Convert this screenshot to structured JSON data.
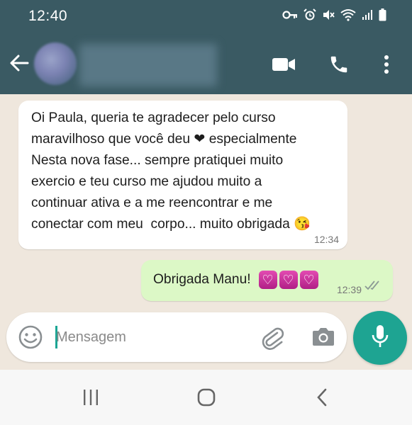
{
  "status_bar": {
    "time": "12:40",
    "icons": [
      "key-icon",
      "alarm-icon",
      "mute-icon",
      "wifi-icon",
      "signal-icon",
      "battery-icon"
    ]
  },
  "header": {
    "contact_name": "",
    "icons": [
      "back-arrow-icon",
      "video-call-icon",
      "voice-call-icon",
      "more-options-icon"
    ],
    "colors": {
      "bar": "#3a5a63"
    }
  },
  "messages": [
    {
      "direction": "incoming",
      "lines": [
        "Oi Paula, queria te agradecer pelo curso",
        "maravilhoso que você deu ❤ especialmente",
        "Nesta nova fase... sempre pratiquei muito",
        "exercio e teu curso me ajudou muito a",
        "continuar ativa e a me reencontrar e me",
        "conectar com meu  corpo... muito obrigada 😘"
      ],
      "time": "12:34"
    },
    {
      "direction": "outgoing",
      "text": "Obrigada Manu!",
      "emoji": [
        "💟",
        "💟",
        "💟"
      ],
      "time": "12:39",
      "status": "read-ticks-icon"
    }
  ],
  "composer": {
    "placeholder": "Mensagem",
    "value": "",
    "icons": [
      "emoji-icon",
      "attach-icon",
      "camera-icon",
      "mic-icon"
    ],
    "accent": "#1ea492"
  },
  "nav": {
    "icons": [
      "recent-apps-icon",
      "home-icon",
      "back-icon"
    ]
  }
}
